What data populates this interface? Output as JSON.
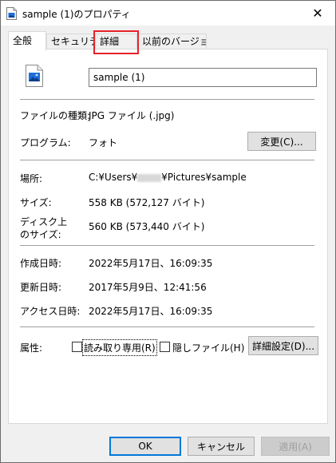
{
  "window": {
    "title": "sample (1)のプロパティ",
    "close_glyph": "✕"
  },
  "tabs": [
    {
      "label": "全般",
      "active": true
    },
    {
      "label": "セキュリティ",
      "active": false
    },
    {
      "label": "詳細",
      "active": false
    },
    {
      "label": "以前のバージョン",
      "active": false
    }
  ],
  "file": {
    "icon": "image-file-icon",
    "name": "sample (1)"
  },
  "fields": {
    "type_label": "ファイルの種類:",
    "type_value": "JPG ファイル (.jpg)",
    "program_label": "プログラム:",
    "program_value": "フォト",
    "change_button": "変更(C)...",
    "location_label": "場所:",
    "location_prefix": "C:¥Users¥",
    "location_suffix": "¥Pictures¥sample",
    "size_label": "サイズ:",
    "size_value": "558 KB (572,127 バイト)",
    "disk_size_label_1": "ディスク上",
    "disk_size_label_2": "のサイズ:",
    "disk_size_value": "560 KB (573,440 バイト)",
    "created_label": "作成日時:",
    "created_value": "2022年5月17日、16:09:35",
    "modified_label": "更新日時:",
    "modified_value": "2017年5月9日、12:41:56",
    "accessed_label": "アクセス日時:",
    "accessed_value": "2022年5月17日、16:09:35",
    "attributes_label": "属性:",
    "readonly_label": "読み取り専用(R)",
    "hidden_label": "隠しファイル(H)",
    "advanced_button": "詳細設定(D)..."
  },
  "footer": {
    "ok": "OK",
    "cancel": "キャンセル",
    "apply": "適用(A)"
  },
  "colors": {
    "highlight": "#e8222b",
    "default_button_border": "#0078d7"
  }
}
